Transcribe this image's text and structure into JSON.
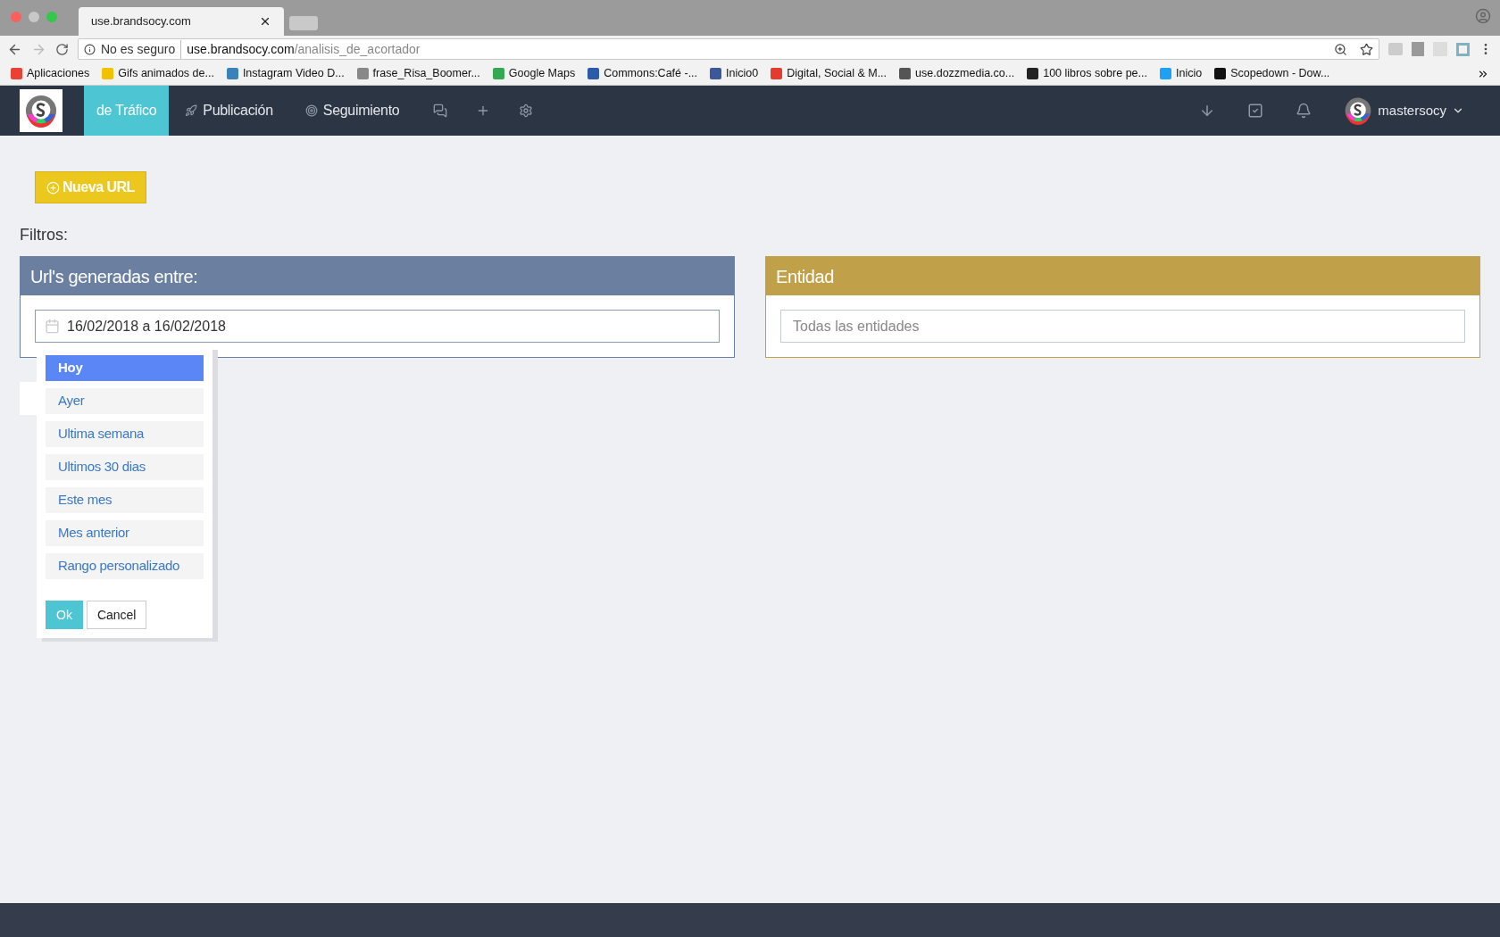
{
  "browser": {
    "tab_title": "use.brandsocy.com",
    "security": "No es seguro",
    "url_host": "use.brandsocy.com",
    "url_path": "/analisis_de_acortador",
    "bookmarks": [
      {
        "label": "Aplicaciones",
        "color": "#e94235"
      },
      {
        "label": "Gifs animados de...",
        "color": "#f2c200"
      },
      {
        "label": "Instagram Video D...",
        "color": "#3b82b8"
      },
      {
        "label": "frase_Risa_Boomer...",
        "color": "#888888"
      },
      {
        "label": "Google Maps",
        "color": "#34a853"
      },
      {
        "label": "Commons:Café -...",
        "color": "#2a5aa8"
      },
      {
        "label": "Inicio0",
        "color": "#3b5998"
      },
      {
        "label": "Digital, Social & M...",
        "color": "#e53a2f"
      },
      {
        "label": "use.dozzmedia.co...",
        "color": "#555555"
      },
      {
        "label": "100 libros sobre pe...",
        "color": "#222222"
      },
      {
        "label": "Inicio",
        "color": "#1da1f2"
      },
      {
        "label": "Scopedown - Dow...",
        "color": "#111111"
      }
    ]
  },
  "nav": {
    "items": [
      {
        "label": "de Tráfico",
        "selected": true
      },
      {
        "label": "Publicación",
        "selected": false
      },
      {
        "label": "Seguimiento",
        "selected": false
      }
    ],
    "user": "mastersocy"
  },
  "new_button": "Nueva URL",
  "filters_label": "Filtros:",
  "date_panel": {
    "title": "Url's generadas entre:",
    "value": "16/02/2018 a 16/02/2018",
    "ranges": [
      {
        "label": "Hoy",
        "selected": true
      },
      {
        "label": "Ayer",
        "selected": false
      },
      {
        "label": "Ultima semana",
        "selected": false
      },
      {
        "label": "Ultimos 30 dias",
        "selected": false
      },
      {
        "label": "Este mes",
        "selected": false
      },
      {
        "label": "Mes anterior",
        "selected": false
      },
      {
        "label": "Rango personalizado",
        "selected": false
      }
    ],
    "ok": "Ok",
    "cancel": "Cancel"
  },
  "entity_panel": {
    "title": "Entidad",
    "placeholder": "Todas las entidades"
  }
}
